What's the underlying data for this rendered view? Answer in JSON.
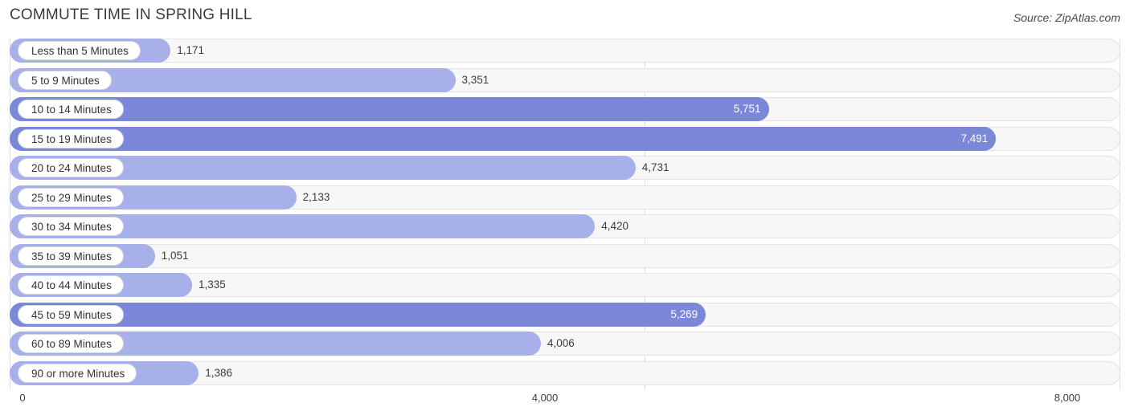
{
  "header": {
    "title": "COMMUTE TIME IN SPRING HILL",
    "source": "Source: ZipAtlas.com"
  },
  "colors": {
    "bar_light": "#a7b0e8",
    "bar_dark": "#7b87d8",
    "track": "#f7f7f7",
    "track_border": "#e3e3e3",
    "grid": "#e0e0e0",
    "text": "#3c3c3c"
  },
  "chart_data": {
    "type": "bar",
    "orientation": "horizontal",
    "title": "COMMUTE TIME IN SPRING HILL",
    "xlabel": "",
    "ylabel": "",
    "xlim": [
      0,
      8000
    ],
    "grid": true,
    "legend": "none",
    "ticks": [
      "0",
      "4,000",
      "8,000"
    ],
    "tick_values": [
      0,
      4000,
      8000
    ],
    "categories": [
      "Less than 5 Minutes",
      "5 to 9 Minutes",
      "10 to 14 Minutes",
      "15 to 19 Minutes",
      "20 to 24 Minutes",
      "25 to 29 Minutes",
      "30 to 34 Minutes",
      "35 to 39 Minutes",
      "40 to 44 Minutes",
      "45 to 59 Minutes",
      "60 to 89 Minutes",
      "90 or more Minutes"
    ],
    "values": [
      1171,
      3351,
      5751,
      7491,
      4731,
      2133,
      4420,
      1051,
      1335,
      5269,
      4006,
      1386
    ],
    "value_labels": [
      "1,171",
      "3,351",
      "5,751",
      "7,491",
      "4,731",
      "2,133",
      "4,420",
      "1,051",
      "1,335",
      "5,269",
      "4,006",
      "1,386"
    ],
    "label_position": [
      "outside",
      "outside",
      "inside",
      "inside",
      "outside",
      "outside",
      "outside",
      "outside",
      "outside",
      "inside",
      "outside",
      "outside"
    ],
    "bar_shade": [
      "light",
      "light",
      "dark",
      "dark",
      "light",
      "light",
      "light",
      "light",
      "light",
      "dark",
      "light",
      "light"
    ]
  }
}
